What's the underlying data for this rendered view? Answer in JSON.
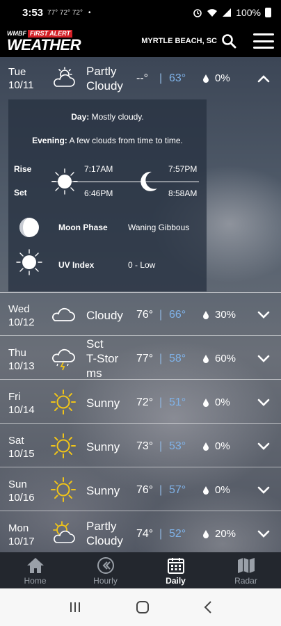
{
  "status_bar": {
    "time": "3:53",
    "temps": "77° 72° 72°",
    "dot": "•",
    "battery": "100%"
  },
  "header": {
    "logo_station": "WMBF",
    "logo_tag": "FIRST ALERT",
    "logo_title": "WEATHER",
    "location": "MYRTLE BEACH, SC"
  },
  "expanded": {
    "day": "Tue",
    "date": "10/11",
    "condition": "Partly Cloudy",
    "hi": "--°",
    "lo": "63°",
    "precip": "0%",
    "icon": "partly-cloudy-icon",
    "day_label": "Day:",
    "day_text": "Mostly cloudy.",
    "evening_label": "Evening:",
    "evening_text": "A few clouds from time to time.",
    "rise_label": "Rise",
    "set_label": "Set",
    "sunrise": "7:17AM",
    "sunset": "6:46PM",
    "moonrise": "7:57PM",
    "moonset": "8:58AM",
    "moon_phase_label": "Moon Phase",
    "moon_phase": "Waning Gibbous",
    "uv_label": "UV Index",
    "uv": "0 - Low"
  },
  "days": [
    {
      "day": "Wed",
      "date": "10/12",
      "condition": "Cloudy",
      "hi": "76°",
      "lo": "66°",
      "precip": "30%",
      "icon": "cloudy-icon"
    },
    {
      "day": "Thu",
      "date": "10/13",
      "condition": "Sct T-Storms",
      "condition_lines": [
        "Sct",
        "T-Stor",
        "ms"
      ],
      "hi": "77°",
      "lo": "58°",
      "precip": "60%",
      "icon": "thunderstorm-icon"
    },
    {
      "day": "Fri",
      "date": "10/14",
      "condition": "Sunny",
      "hi": "72°",
      "lo": "51°",
      "precip": "0%",
      "icon": "sun-icon"
    },
    {
      "day": "Sat",
      "date": "10/15",
      "condition": "Sunny",
      "hi": "73°",
      "lo": "53°",
      "precip": "0%",
      "icon": "sun-icon"
    },
    {
      "day": "Sun",
      "date": "10/16",
      "condition": "Sunny",
      "hi": "76°",
      "lo": "57°",
      "precip": "0%",
      "icon": "sun-icon"
    },
    {
      "day": "Mon",
      "date": "10/17",
      "condition": "Partly Cloudy",
      "hi": "74°",
      "lo": "52°",
      "precip": "20%",
      "icon": "partly-cloudy-icon"
    }
  ],
  "nav": {
    "home": "Home",
    "hourly": "Hourly",
    "daily": "Daily",
    "radar": "Radar",
    "active": "Daily"
  },
  "colors": {
    "low_temp": "#7fb2e8",
    "sun": "#f0c419",
    "header_bg": "#000000",
    "accent_red": "#d31f26"
  }
}
